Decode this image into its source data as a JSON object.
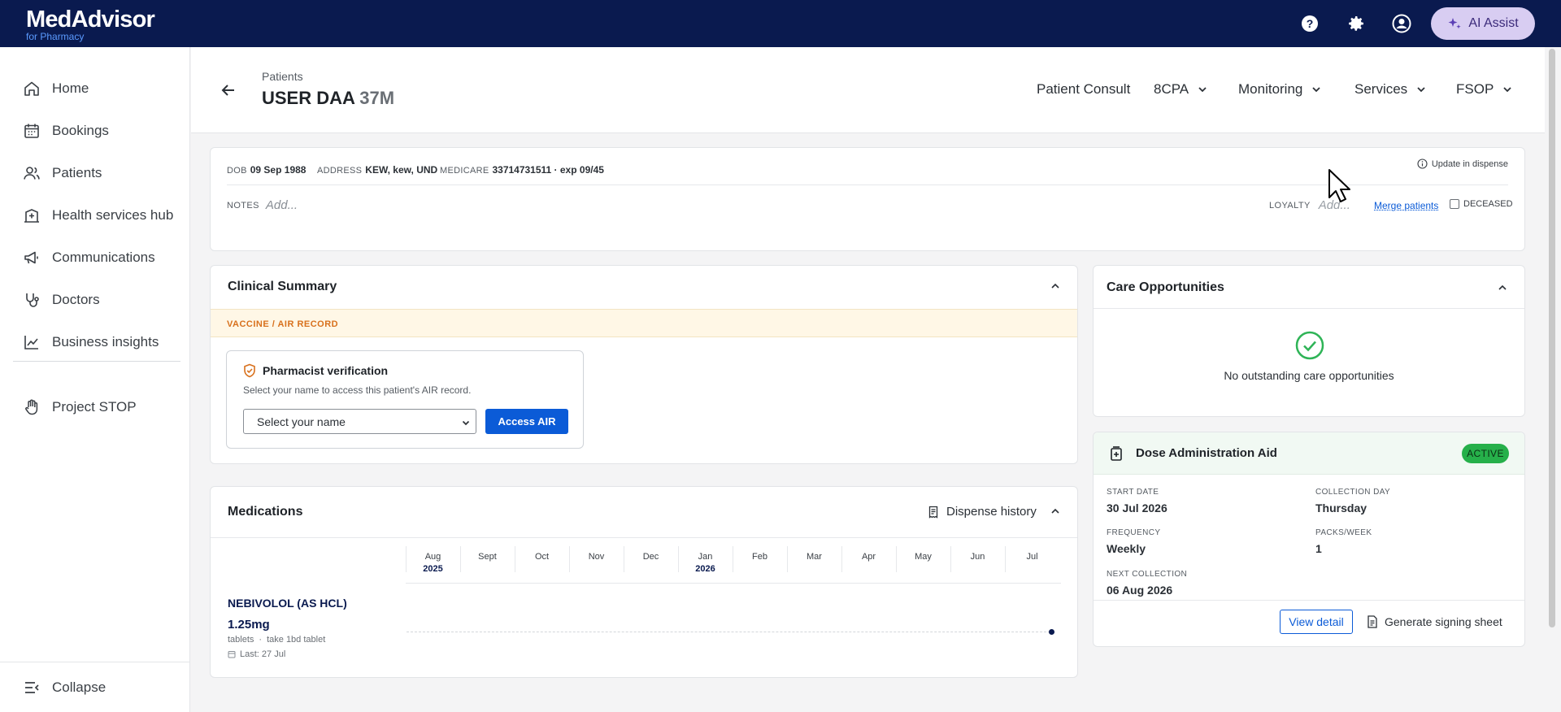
{
  "brand": {
    "name": "MedAdvisor",
    "sub": "for Pharmacy"
  },
  "topbar": {
    "ai_label": "AI Assist"
  },
  "sidebar": {
    "items": [
      {
        "label": "Home",
        "icon": "home-icon"
      },
      {
        "label": "Bookings",
        "icon": "calendar-icon"
      },
      {
        "label": "Patients",
        "icon": "users-icon"
      },
      {
        "label": "Health services hub",
        "icon": "hospital-icon"
      },
      {
        "label": "Communications",
        "icon": "megaphone-icon"
      },
      {
        "label": "Doctors",
        "icon": "stethoscope-icon"
      },
      {
        "label": "Business insights",
        "icon": "chart-icon"
      },
      {
        "label": "Project STOP",
        "icon": "hand-icon"
      }
    ],
    "collapse_label": "Collapse"
  },
  "header": {
    "breadcrumb": "Patients",
    "patient_name": "USER DAA",
    "patient_age": "37M",
    "menu": [
      "Patient Consult",
      "8CPA",
      "Monitoring",
      "Services",
      "FSOP"
    ]
  },
  "info": {
    "dob_label": "DOB",
    "dob": "09 Sep 1988",
    "address_label": "ADDRESS",
    "address": "KEW, kew, UND",
    "medicare_label": "MEDICARE",
    "medicare": "33714731511 · exp 09/45",
    "update_link": "Update in dispense",
    "notes_label": "NOTES",
    "notes_placeholder": "Add...",
    "loyalty_label": "LOYALTY",
    "loyalty_placeholder": "Add...",
    "merge_link": "Merge patients",
    "deceased_label": "DECEASED"
  },
  "clinical": {
    "title": "Clinical Summary",
    "vaccine_band": "VACCINE / AIR RECORD",
    "verify_title": "Pharmacist verification",
    "verify_desc": "Select your name to access this patient's AIR record.",
    "select_value": "Select your name",
    "access_button": "Access AIR"
  },
  "medications": {
    "title": "Medications",
    "dispense_history": "Dispense history",
    "months": [
      {
        "m": "Aug",
        "y": "2025"
      },
      {
        "m": "Sept",
        "y": ""
      },
      {
        "m": "Oct",
        "y": ""
      },
      {
        "m": "Nov",
        "y": ""
      },
      {
        "m": "Dec",
        "y": ""
      },
      {
        "m": "Jan",
        "y": "2026"
      },
      {
        "m": "Feb",
        "y": ""
      },
      {
        "m": "Mar",
        "y": ""
      },
      {
        "m": "Apr",
        "y": ""
      },
      {
        "m": "May",
        "y": ""
      },
      {
        "m": "Jun",
        "y": ""
      },
      {
        "m": "Jul",
        "y": ""
      }
    ],
    "drug_name": "NEBIVOLOL (AS HCL)",
    "strength": "1.25mg",
    "form": "tablets",
    "directions": "take 1bd tablet",
    "last": "Last: 27 Jul"
  },
  "care": {
    "title": "Care Opportunities",
    "empty_text": "No outstanding care opportunities"
  },
  "daa": {
    "title": "Dose Administration Aid",
    "status": "ACTIVE",
    "start_label": "START DATE",
    "start": "30 Jul 2026",
    "collection_label": "COLLECTION DAY",
    "collection": "Thursday",
    "frequency_label": "FREQUENCY",
    "frequency": "Weekly",
    "packs_label": "PACKS/WEEK",
    "packs": "1",
    "next_label": "NEXT COLLECTION",
    "next": "06 Aug 2026",
    "view_button": "View detail",
    "generate_button": "Generate signing sheet"
  },
  "colors": {
    "navy": "#0a1a4f",
    "accent_blue": "#0b5bd7",
    "active_green": "#26b04a",
    "vaccine_orange": "#d8701c"
  }
}
